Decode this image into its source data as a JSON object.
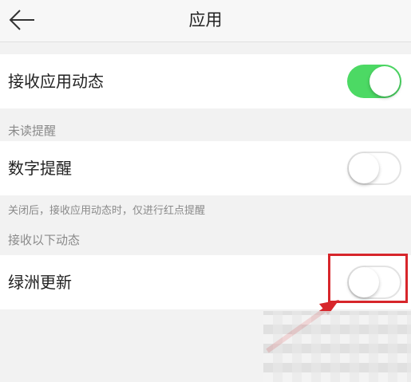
{
  "header": {
    "title": "应用",
    "back_icon": "arrow-left-icon"
  },
  "rows": [
    {
      "label": "接收应用动态",
      "toggle_on": true
    },
    {
      "label": "数字提醒",
      "toggle_on": false
    },
    {
      "label": "绿洲更新",
      "toggle_on": false
    }
  ],
  "sections": {
    "unread_reminder": "未读提醒",
    "receive_following": "接收以下动态"
  },
  "hint": "关闭后，接收应用动态时，仅进行红点提醒",
  "colors": {
    "toggle_on": "#4cd964",
    "annotation": "#d7262b"
  }
}
